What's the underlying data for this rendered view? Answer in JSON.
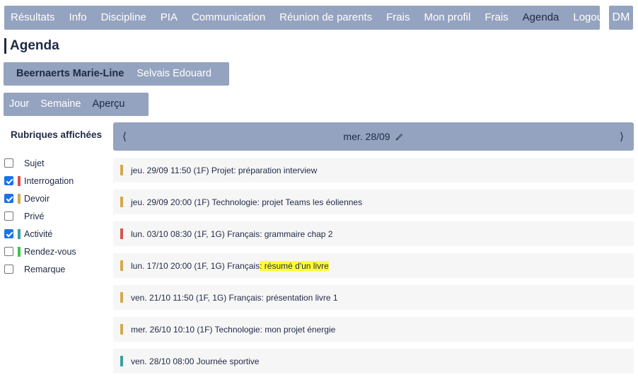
{
  "colors": {
    "nav_bg": "#94a3bf",
    "interrogation": "#d9534f",
    "devoir": "#d4a94a",
    "activite": "#3a9ea5",
    "rendez_vous": "#3ec64a",
    "highlight": "#ffff33"
  },
  "nav": {
    "items": [
      "Résultats",
      "Info",
      "Discipline",
      "PIA",
      "Communication",
      "Réunion de parents",
      "Frais",
      "Mon profil",
      "Frais",
      "Agenda",
      "Logout"
    ],
    "active": "Agenda"
  },
  "user": {
    "initials": "DM"
  },
  "page": {
    "title": "Agenda"
  },
  "students": {
    "items": [
      "Beernaerts Marie-Line",
      "Selvais Edouard"
    ],
    "active": "Beernaerts Marie-Line"
  },
  "views": {
    "items": [
      "Jour",
      "Semaine",
      "Aperçu"
    ]
  },
  "filters": {
    "title": "Rubriques affichées",
    "items": [
      {
        "label": "Sujet",
        "checked": false,
        "color": ""
      },
      {
        "label": "Interrogation",
        "checked": true,
        "color": "#d9534f"
      },
      {
        "label": "Devoir",
        "checked": true,
        "color": "#d4a94a"
      },
      {
        "label": "Privé",
        "checked": false,
        "color": ""
      },
      {
        "label": "Activité",
        "checked": true,
        "color": "#3a9ea5"
      },
      {
        "label": "Rendez-vous",
        "checked": false,
        "color": "#3ec64a"
      },
      {
        "label": "Remarque",
        "checked": false,
        "color": ""
      }
    ]
  },
  "day": {
    "prev_label": "⟨",
    "next_label": "⟩",
    "date": "mer. 28/09"
  },
  "events": [
    {
      "text": "jeu. 29/09 11:50 (1F) Projet: préparation interview",
      "color": "#d4a94a"
    },
    {
      "text": "jeu. 29/09 20:00 (1F) Technologie: projet Teams les éoliennes",
      "color": "#d4a94a"
    },
    {
      "text": "lun. 03/10 08:30 (1F, 1G) Français: grammaire chap 2",
      "color": "#d9534f"
    },
    {
      "text": "lun. 17/10 20:00 (1F, 1G) Français",
      "text_highlight": ": résumé d'un livre",
      "color": "#d4a94a"
    },
    {
      "text": "ven. 21/10 11:50 (1F, 1G) Français: présentation livre 1",
      "color": "#d4a94a"
    },
    {
      "text": "mer. 26/10 10:10 (1F) Technologie: mon projet énergie",
      "color": "#d4a94a"
    },
    {
      "text": "ven. 28/10 08:00 Journée sportive",
      "color": "#3a9ea5"
    }
  ]
}
